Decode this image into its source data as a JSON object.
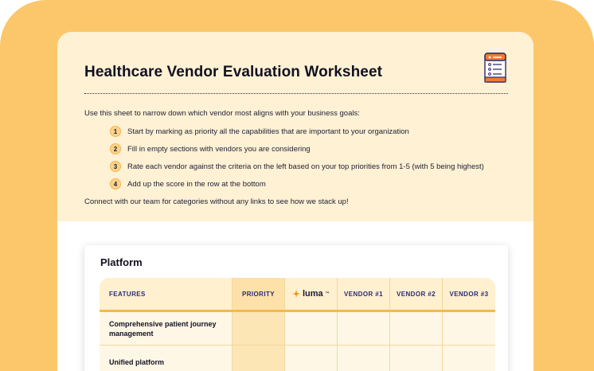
{
  "header": {
    "title": "Healthcare Vendor Evaluation Worksheet",
    "icon": "checklist-document-icon"
  },
  "intro": {
    "lead": "Use this sheet to narrow down which vendor most aligns with your business goals:",
    "steps": [
      {
        "num": "1",
        "text": "Start by marking as priority all the capabilities that are important to your organization"
      },
      {
        "num": "2",
        "text": "Fill in empty sections with vendors you are considering"
      },
      {
        "num": "3",
        "text": "Rate each vendor against the criteria on the left based on your top priorities from 1-5 (with 5 being highest)"
      },
      {
        "num": "4",
        "text": "Add up the score in the row at the bottom"
      }
    ],
    "closing": "Connect with our team for categories without any links to see how we stack up!"
  },
  "platform": {
    "title": "Platform",
    "columns": {
      "features": "FEATURES",
      "priority": "PRIORITY",
      "luma": "luma",
      "luma_tm": "™",
      "vendor1": "VENDOR #1",
      "vendor2": "VENDOR #2",
      "vendor3": "VENDOR #3"
    },
    "rows": [
      {
        "feature": "Comprehensive patient journey management"
      },
      {
        "feature": "Unified platform"
      }
    ]
  },
  "colors": {
    "frame": "#fcc76a",
    "intro_bg": "#fff1d4",
    "header_accent": "#f7b84a",
    "header_text": "#2a2a7a",
    "luma_orange": "#f28b1e"
  }
}
